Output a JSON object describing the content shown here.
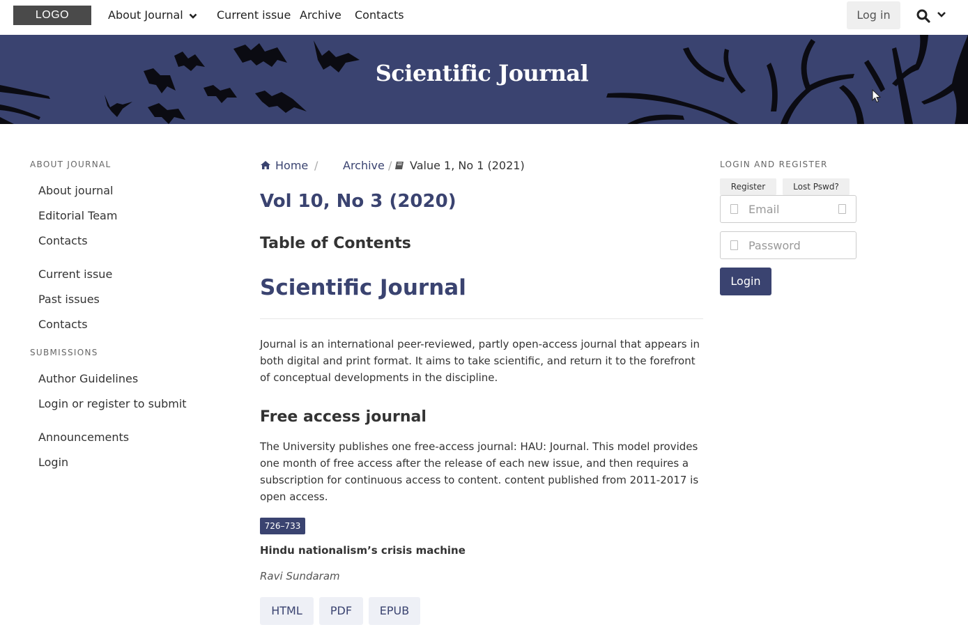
{
  "header": {
    "logo": "LOGO",
    "nav": [
      "About Journal",
      "Current issue",
      "Archive",
      "Contacts"
    ],
    "login": "Log in",
    "search_icon": "search-icon"
  },
  "banner": {
    "title": "Scientific Journal"
  },
  "left_sidebar": {
    "about_heading": "ABOUT JOURNAL",
    "about_links": [
      "About journal",
      "Editorial Team",
      "Contacts",
      "Current issue",
      "Past issues",
      "Contacts"
    ],
    "submissions_heading": "SUBMISSIONS",
    "submission_links": [
      "Author Guidelines",
      "Login or register to submit",
      "Announcements",
      "Login"
    ]
  },
  "breadcrumb": {
    "home": "Home",
    "separator": "/",
    "archive": "Archive",
    "current": "Value 1, No 1 (2021)"
  },
  "main": {
    "issue_title": "Vol 10, No 3 (2020)",
    "toc_title": "Table of Contents",
    "journal_title": "Scientific Journal",
    "description": "Journal is an international peer-reviewed, partly open-access journal that appears in both digital and print format. It aims to take scientific, and return it to the forefront of conceptual developments in the discipline.",
    "section_title": "Free access journal",
    "section_text": "The University publishes one free-access journal: HAU: Journal. This model provides one month of free access after the release of each new issue, and then requires a subscription for continuous access to content. content published from 2011-2017 is open access.",
    "article": {
      "pages": "726–733",
      "title": "Hindu nationalism’s crisis machine",
      "author": "Ravi Sundaram",
      "galleys": [
        "HTML",
        "PDF",
        "EPUB"
      ]
    }
  },
  "right_sidebar": {
    "heading": "LOGIN AND REGISTER",
    "register": "Register",
    "lost_password": "Lost Pswd?",
    "email_placeholder": "Email",
    "password_placeholder": "Password",
    "login_button": "Login"
  },
  "colors": {
    "brand": "#3a4370",
    "banner": "#3a4370"
  }
}
